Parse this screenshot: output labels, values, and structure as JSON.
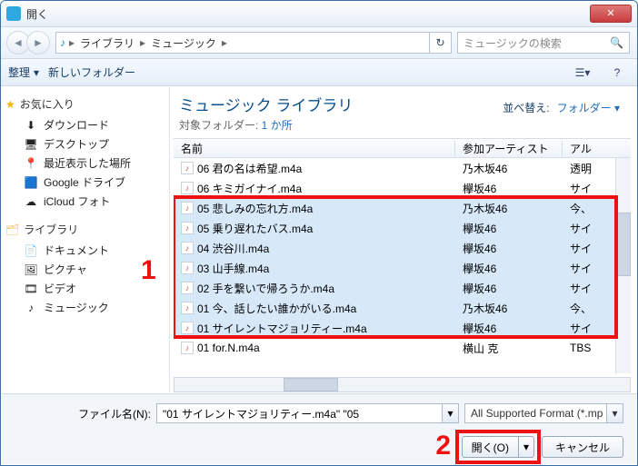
{
  "titlebar": {
    "title": "開く",
    "close": "✕"
  },
  "nav": {
    "path_root_icon": "♪",
    "segments": [
      "ライブラリ",
      "ミュージック"
    ],
    "chevron": "▸",
    "refresh_icon": "↻",
    "search_placeholder": "ミュージックの検索",
    "search_icon": "🔍"
  },
  "toolbar": {
    "organize": "整理",
    "newfolder": "新しいフォルダー",
    "view_icon": "☰",
    "help_icon": "?"
  },
  "sidebar": {
    "favorites_head": "お気に入り",
    "favorites": [
      {
        "icon": "⬇",
        "label": "ダウンロード"
      },
      {
        "icon": "🖥",
        "label": "デスクトップ"
      },
      {
        "icon": "📍",
        "label": "最近表示した場所"
      },
      {
        "icon": "🟦",
        "label": "Google ドライブ"
      },
      {
        "icon": "☁",
        "label": "iCloud フォト"
      }
    ],
    "libraries_head": "ライブラリ",
    "libraries": [
      {
        "icon": "📄",
        "label": "ドキュメント"
      },
      {
        "icon": "🖼",
        "label": "ピクチャ"
      },
      {
        "icon": "🎞",
        "label": "ビデオ"
      },
      {
        "icon": "♪",
        "label": "ミュージック"
      }
    ]
  },
  "content": {
    "lib_title": "ミュージック ライブラリ",
    "lib_sub_prefix": "対象フォルダー: ",
    "lib_sub_link": "1 か所",
    "sort_label": "並べ替え:",
    "sort_value": "フォルダー",
    "columns": {
      "name": "名前",
      "artist": "参加アーティスト",
      "album": "アル"
    },
    "rows": [
      {
        "name": "06 君の名は希望.m4a",
        "artist": "乃木坂46",
        "album": "透明",
        "sel": false,
        "cut": true
      },
      {
        "name": "06 キミガイナイ.m4a",
        "artist": "欅坂46",
        "album": "サイ",
        "sel": false
      },
      {
        "name": "05 悲しみの忘れ方.m4a",
        "artist": "乃木坂46",
        "album": "今、",
        "sel": true
      },
      {
        "name": "05 乗り遅れたバス.m4a",
        "artist": "欅坂46",
        "album": "サイ",
        "sel": true
      },
      {
        "name": "04 渋谷川.m4a",
        "artist": "欅坂46",
        "album": "サイ",
        "sel": true
      },
      {
        "name": "03 山手線.m4a",
        "artist": "欅坂46",
        "album": "サイ",
        "sel": true
      },
      {
        "name": "02 手を繋いで帰ろうか.m4a",
        "artist": "欅坂46",
        "album": "サイ",
        "sel": true
      },
      {
        "name": "01 今、話したい誰かがいる.m4a",
        "artist": "乃木坂46",
        "album": "今、",
        "sel": true
      },
      {
        "name": "01 サイレントマジョリティー.m4a",
        "artist": "欅坂46",
        "album": "サイ",
        "sel": true
      },
      {
        "name": "01 for.N.m4a",
        "artist": "横山 克",
        "album": "TBS",
        "sel": false
      }
    ]
  },
  "footer": {
    "fn_label": "ファイル名(N):",
    "fn_value": "\"01 サイレントマジョリティー.m4a\" \"05 ",
    "filter": "All Supported Format (*.mp",
    "open_label": "開く(O)",
    "cancel_label": "キャンセル"
  },
  "anno": {
    "one": "1",
    "two": "2"
  }
}
